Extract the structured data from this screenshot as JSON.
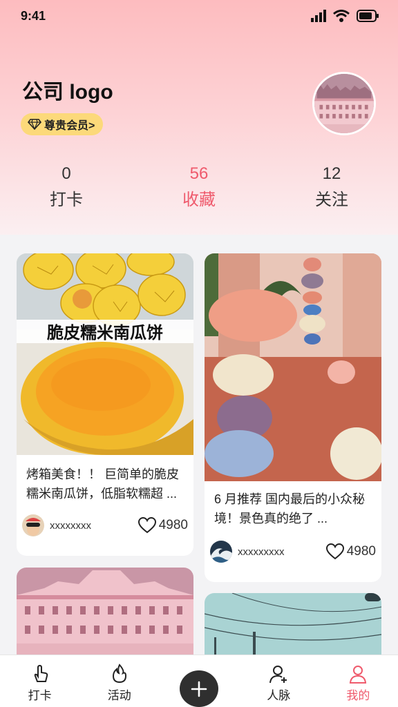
{
  "status": {
    "time": "9:41"
  },
  "profile": {
    "brand": "公司 logo",
    "vip_label": "尊贵会员>"
  },
  "stats": [
    {
      "value": "0",
      "label": "打卡"
    },
    {
      "value": "56",
      "label": "收藏"
    },
    {
      "value": "12",
      "label": "关注"
    }
  ],
  "feed": [
    {
      "image_caption": "脆皮糯米南瓜饼",
      "text": "烤箱美食！！ 巨简单的脆皮糯米南瓜饼，低脂软糯超 ...",
      "user": "xxxxxxxx",
      "likes": "4980"
    },
    {
      "text": "6 月推荐 国内最后的小众秘境！景色真的绝了 ...",
      "user": "xxxxxxxxx",
      "likes": "4980"
    }
  ],
  "tabs": [
    {
      "label": "打卡"
    },
    {
      "label": "活动"
    },
    {
      "label": "人脉"
    },
    {
      "label": "我的"
    }
  ],
  "colors": {
    "accent": "#ef5a6c",
    "vip": "#fcd97a",
    "fab": "#2f2f2f"
  }
}
